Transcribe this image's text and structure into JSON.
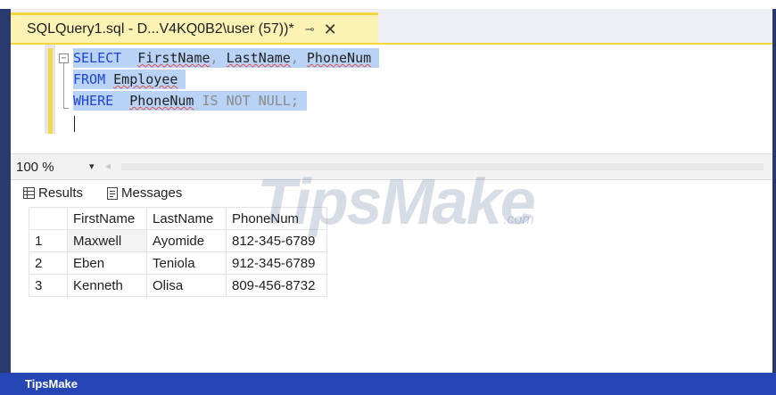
{
  "tab": {
    "title": "SQLQuery1.sql - D...V4KQ0B2\\user (57))*",
    "pin_glyph": "⊸",
    "close_glyph": "✕"
  },
  "editor": {
    "line1": {
      "kw": "SELECT",
      "c1": "FirstName",
      "sep1": ", ",
      "c2": "LastName",
      "sep2": ", ",
      "c3": "PhoneNum"
    },
    "line2": {
      "kw": "FROM",
      "table": "Employee"
    },
    "line3": {
      "kw": "WHERE",
      "col": "PhoneNum",
      "rest": "IS NOT NULL;"
    },
    "collapse_glyph": "−"
  },
  "zoom": {
    "value": "100 %",
    "arrow": "▾",
    "scroll_left": "◂"
  },
  "results_tabs": {
    "results": "Results",
    "messages": "Messages"
  },
  "grid": {
    "headers": [
      "FirstName",
      "LastName",
      "PhoneNum"
    ],
    "rows": [
      {
        "n": "1",
        "first": "Maxwell",
        "last": "Ayomide",
        "phone": "812-345-6789"
      },
      {
        "n": "2",
        "first": "Eben",
        "last": "Teniola",
        "phone": "912-345-6789"
      },
      {
        "n": "3",
        "first": "Kenneth",
        "last": "Olisa",
        "phone": "809-456-8732"
      }
    ]
  },
  "watermark": {
    "main": "TipsMake",
    "suffix": ".com"
  },
  "footer": {
    "brand": "TipsMake"
  },
  "colors": {
    "keyword": "#1f43d8",
    "selection": "#b8d3f5",
    "tab_active": "#fbf3b4",
    "footer": "#2746b5"
  }
}
